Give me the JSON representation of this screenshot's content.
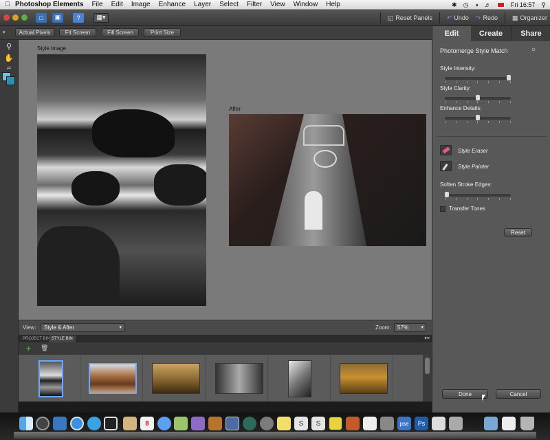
{
  "menubar": {
    "app_name": "Photoshop Elements",
    "menus": [
      "File",
      "Edit",
      "Image",
      "Enhance",
      "Layer",
      "Select",
      "Filter",
      "View",
      "Window",
      "Help"
    ],
    "clock": "Fri 16:57",
    "status_icons": [
      "bluetooth-icon",
      "history-icon",
      "wifi-icon",
      "volume-icon",
      "language-flag-icon",
      "search-icon"
    ]
  },
  "toolbar": {
    "reset_panels": "Reset Panels",
    "undo": "Undo",
    "redo": "Redo",
    "organizer": "Organizer"
  },
  "options": {
    "actual_pixels": "Actual Pixels",
    "fit_screen": "Fit Screen",
    "fill_screen": "Fill Screen",
    "print_size": "Print Size"
  },
  "canvas": {
    "style_image_caption": "Style Image",
    "after_caption": "After"
  },
  "viewbar": {
    "view_label": "View:",
    "view_value": "Style & After",
    "zoom_label": "Zoom:",
    "zoom_value": "57%"
  },
  "bin": {
    "tabs": [
      "PROJECT BIN",
      "STYLE BIN"
    ],
    "active_tab": "STYLE BIN",
    "thumbnails": [
      "coastal-rocks",
      "rusty-truck",
      "sepia-landscape",
      "church-facade",
      "portrait-bw",
      "tree-landscape"
    ]
  },
  "panel": {
    "tabs": [
      "Edit",
      "Create",
      "Share"
    ],
    "active_tab": "Edit",
    "title": "Photomerge Style Match",
    "style_intensity_label": "Style Intensity:",
    "style_intensity": 1.0,
    "style_clarity_label": "Style Clarity:",
    "style_clarity": 0.5,
    "enhance_details_label": "Enhance Details:",
    "enhance_details": 0.5,
    "style_eraser": "Style Eraser",
    "style_painter": "Style Painter",
    "soften_label": "Soften Stroke Edges:",
    "soften": 0.0,
    "transfer_tones": "Transfer Tones",
    "transfer_tones_checked": false,
    "reset": "Reset",
    "done": "Done",
    "cancel": "Cancel"
  },
  "dock": {
    "icons": [
      "finder-icon",
      "dashboard-icon",
      "preview-icon",
      "safari-icon",
      "ichat-icon",
      "photo-booth-icon",
      "address-book-icon",
      "ical-icon",
      "itunes-icon",
      "iphoto-icon",
      "imovie-icon",
      "garageband-icon",
      "spaces-icon",
      "time-machine-icon",
      "system-preferences-icon",
      "stickies-icon",
      "skype-icon",
      "skype2-icon",
      "widget-icon",
      "app-icon",
      "textedit-icon",
      "script-icon",
      "pse-icon",
      "photoshop-icon",
      "bridge-icon",
      "utility-icon",
      "folder-icon",
      "documents-icon",
      "trash-icon"
    ],
    "pse_label": "pse",
    "ps_label": "Ps"
  }
}
